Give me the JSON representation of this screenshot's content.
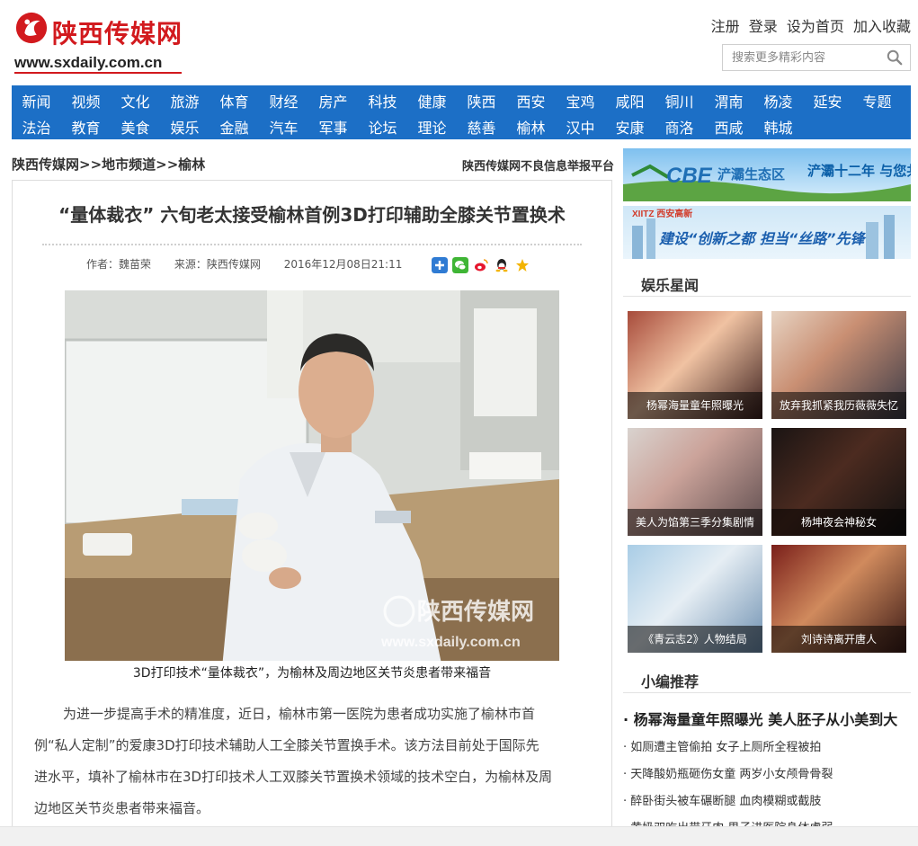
{
  "header": {
    "logo_title": "陕西传媒网",
    "logo_url": "www.sxdaily.com.cn",
    "links": [
      "注册",
      "登录",
      "设为首页",
      "加入收藏"
    ],
    "search_placeholder": "搜索更多精彩内容",
    "brand_color": "#d21a1e"
  },
  "nav": {
    "color": "#1c6fc6",
    "row1": [
      "新闻",
      "视频",
      "文化",
      "旅游",
      "体育",
      "财经",
      "房产",
      "科技",
      "健康",
      "陕西",
      "西安",
      "宝鸡",
      "咸阳",
      "铜川",
      "渭南",
      "杨凌",
      "延安",
      "专题"
    ],
    "row2": [
      "法治",
      "教育",
      "美食",
      "娱乐",
      "金融",
      "汽车",
      "军事",
      "论坛",
      "理论",
      "慈善",
      "榆林",
      "汉中",
      "安康",
      "商洛",
      "西咸",
      "韩城"
    ]
  },
  "breadcrumb": "陕西传媒网>>地市频道>>榆林",
  "report_link": "陕西传媒网不良信息举报平台",
  "article": {
    "title": "“量体裁衣” 六旬老太接受榆林首例3D打印辅助全膝关节置换术",
    "author": "作者：魏苗荣",
    "source": "来源：陕西传媒网",
    "date": "2016年12月08日21:11",
    "share_icons": [
      "plus-share-icon",
      "wechat-icon",
      "weibo-icon",
      "qq-icon",
      "favorite-icon"
    ],
    "photo_watermark": "陕西传媒网",
    "photo_watermark_url": "www.sxdaily.com.cn",
    "caption": "3D打印技术“量体裁衣”，为榆林及周边地区关节炎患者带来福音",
    "paragraph_lines": [
      "为进一步提高手术的精准度，近日，榆林市第一医院为患者成功实施了榆林市首",
      "例“私人定制”的爱康3D打印技术辅助人工全膝关节置换手术。该方法目前处于国际先",
      "进水平，填补了榆林市在3D打印技术人工双膝关节置换术领域的技术空白，为榆林及周",
      "边地区关节炎患者带来福音。"
    ]
  },
  "sidebar": {
    "banner1": {
      "logo": "CBE",
      "name": "浐灞生态区",
      "slogan": "浐灞十二年 与您共成长"
    },
    "banner2": {
      "logo": "XIITZ 西安高新",
      "slogan": "建设“创新之都 担当“丝路”先锋"
    },
    "ent_title": "娱乐星闻",
    "ent_items": [
      "杨幂海量童年照曝光",
      "放弃我抓紧我历薇薇失忆",
      "美人为馅第三季分集剧情",
      "杨坤夜会神秘女",
      "《青云志2》人物结局",
      "刘诗诗离开唐人"
    ],
    "rec_title": "小编推荐",
    "rec_lead": "· 杨幂海量童年照曝光 美人胚子从小美到大",
    "rec_items": [
      "· 如厕遭主管偷拍 女子上厕所全程被拍",
      "· 天降酸奶瓶砸伤女童 两岁小女颅骨骨裂",
      "· 醉卧街头被车碾断腿 血肉模糊或截肢",
      "· 黄奶双吃出带牙肉 男子进医院身体虚弱"
    ]
  }
}
